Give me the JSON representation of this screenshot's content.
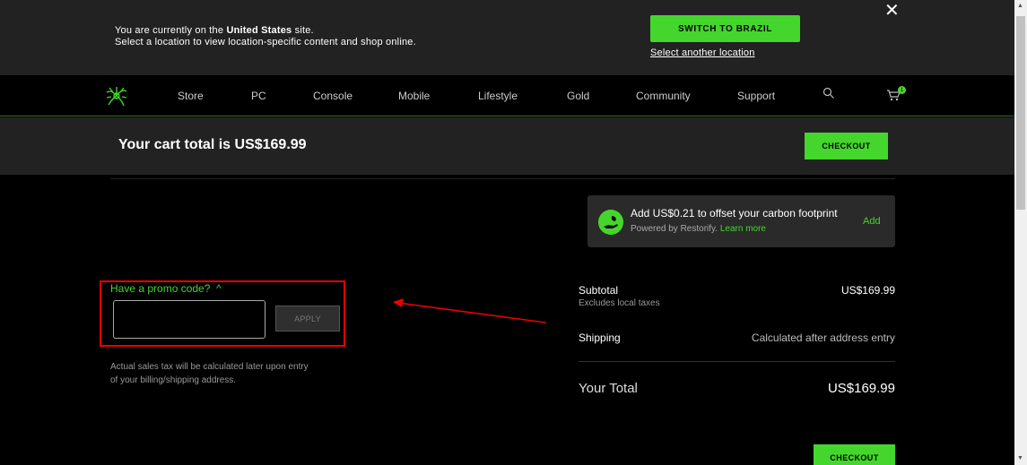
{
  "geo_banner": {
    "line1_prefix": "You are currently on the ",
    "line1_country": "United States",
    "line1_suffix": " site.",
    "line2": "Select a location to view location-specific content and shop online.",
    "switch_label": "SWITCH TO BRAZIL",
    "another_label": "Select another location",
    "close_glyph": "✕"
  },
  "nav": {
    "items": [
      "Store",
      "PC",
      "Console",
      "Mobile",
      "Lifestyle",
      "Gold",
      "Community",
      "Support"
    ],
    "cart_count": "1"
  },
  "cart": {
    "total_title": "Your cart total is US$169.99",
    "checkout_label": "CHECKOUT"
  },
  "carbon": {
    "main": "Add US$0.21 to offset your carbon footprint",
    "powered": "Powered by Restorify.",
    "learn_more": "Learn more",
    "add_label": "Add"
  },
  "promo": {
    "label": "Have a promo code?",
    "chevron": "^",
    "input_value": "",
    "apply_label": "APPLY",
    "tax_note": "Actual sales tax will be calculated later upon entry of your billing/shipping address."
  },
  "summary": {
    "subtotal_label": "Subtotal",
    "subtotal_sub": "Excludes local taxes",
    "subtotal_value": "US$169.99",
    "shipping_label": "Shipping",
    "shipping_value": "Calculated after address entry",
    "total_label": "Your Total",
    "total_value": "US$169.99"
  },
  "colors": {
    "accent": "#44d62c",
    "annotation": "#e00000"
  }
}
